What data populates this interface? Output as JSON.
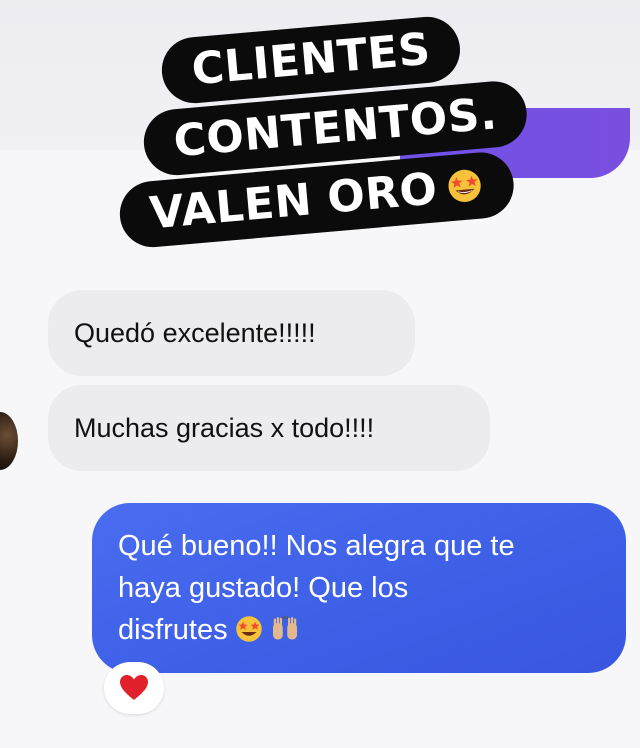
{
  "sticker": {
    "line1": "CLIENTES",
    "line2": "CONTENTOS.",
    "line3": "VALEN ORO",
    "emoji": "star-struck-emoji"
  },
  "messages": {
    "incoming": [
      {
        "text": "Quedó excelente!!!!!"
      },
      {
        "text": "Muchas gracias x todo!!!!"
      }
    ],
    "outgoing": {
      "line1": "Qué bueno!! Nos alegra que te",
      "line2": "haya gustado! Que los",
      "line3": "disfrutes",
      "emojis": [
        "star-struck-emoji",
        "raised-hands-emoji"
      ]
    },
    "reaction": {
      "icon": "red-heart-icon",
      "color": "#e0202b"
    }
  },
  "colors": {
    "outgoing_bubble": "#4264ea",
    "incoming_bubble": "#ececee",
    "header_accent": "#7350e4",
    "sticker_bg": "#0b0b0b"
  }
}
